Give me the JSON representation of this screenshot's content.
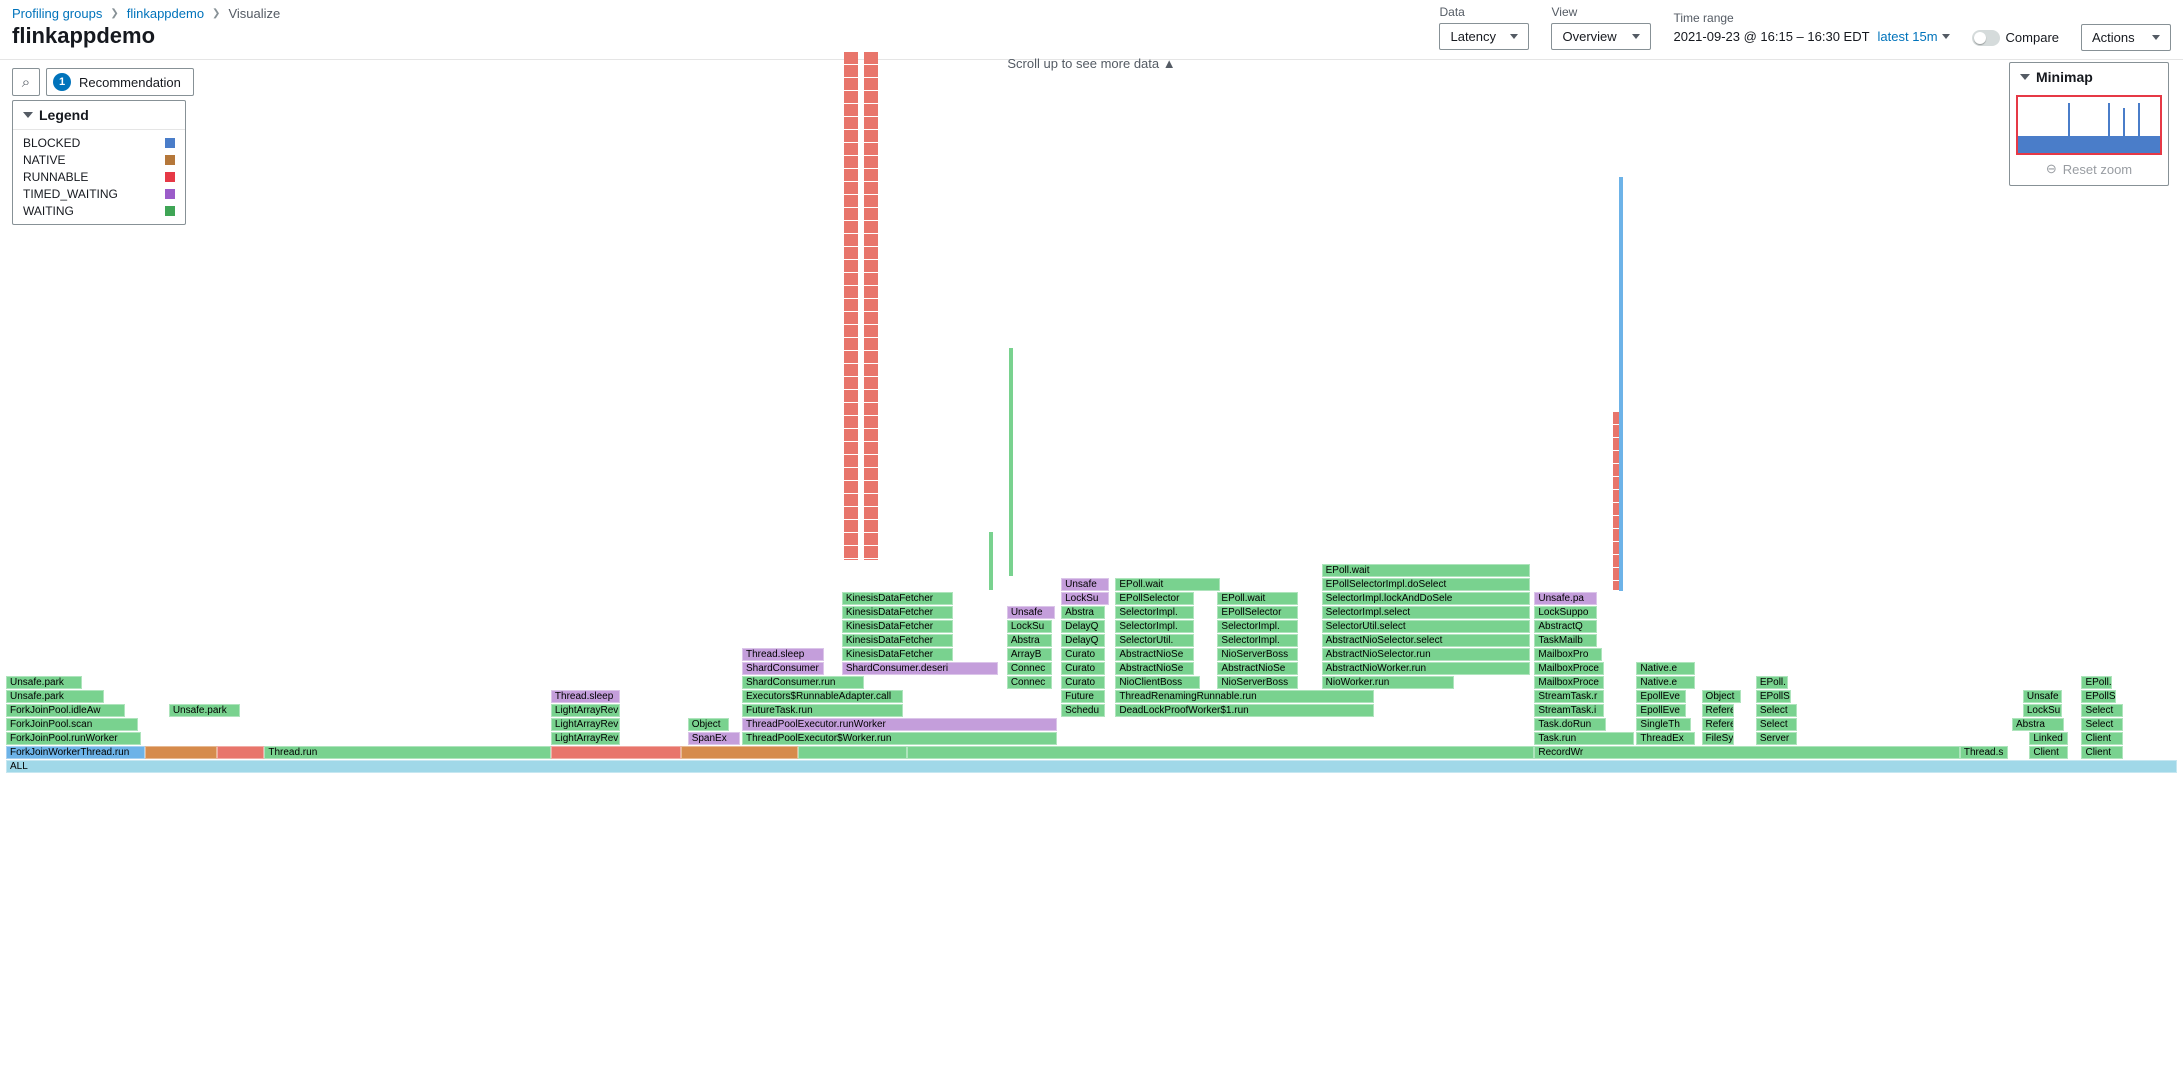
{
  "breadcrumbs": {
    "profiling_groups": "Profiling groups",
    "app": "flinkappdemo",
    "visualize": "Visualize"
  },
  "page_title": "flinkappdemo",
  "controls": {
    "data_label": "Data",
    "data_value": "Latency",
    "view_label": "View",
    "view_value": "Overview",
    "time_range_label": "Time range",
    "time_value": "2021-09-23 @ 16:15 – 16:30 EDT",
    "latest": "latest 15m",
    "compare_label": "Compare",
    "actions": "Actions"
  },
  "recommendation": {
    "count": "1",
    "label": "Recommendation"
  },
  "scroll_hint": "Scroll up to see more data ▲",
  "minimap": {
    "title": "Minimap",
    "reset": "Reset zoom"
  },
  "legend": {
    "title": "Legend",
    "items": [
      {
        "label": "BLOCKED",
        "color": "#4a7dc9"
      },
      {
        "label": "NATIVE",
        "color": "#b5773a"
      },
      {
        "label": "RUNNABLE",
        "color": "#e63946"
      },
      {
        "label": "TIMED_WAITING",
        "color": "#9b5cc9"
      },
      {
        "label": "WAITING",
        "color": "#3fa556"
      }
    ]
  },
  "frames": {
    "all": "ALL",
    "fjwthread": "ForkJoinWorkerThread.run",
    "fjprun": "ForkJoinPool.runWorker",
    "fjpscan": "ForkJoinPool.scan",
    "fjpidle": "ForkJoinPool.idleAw",
    "unsafepark1": "Unsafe.park",
    "unsafepark2": "Unsafe.park",
    "unsafepark3": "Unsafe.park",
    "lightarr1": "LightArrayRev",
    "lightarr2": "LightArrayRev",
    "lightarr3": "LightArrayRev",
    "threadsleep1": "Thread.sleep",
    "threadsleep2": "Thread.sleep",
    "threadrun": "Thread.run",
    "spanex": "SpanEx",
    "object": "Object",
    "tpexworker": "ThreadPoolExecutor$Worker.run",
    "tpexrun": "ThreadPoolExecutor.runWorker",
    "futuretask": "FutureTask.run",
    "execrunnable": "Executors$RunnableAdapter.call",
    "shardconsrun": "ShardConsumer.run",
    "shardcons": "ShardConsumer",
    "shardconsdeseri": "ShardConsumer.deseri",
    "kdf1": "KinesisDataFetcher",
    "kdf2": "KinesisDataFetcher",
    "kdf3": "KinesisDataFetcher",
    "kdf4": "KinesisDataFetcher",
    "kdf5": "KinesisDataFetcher",
    "arrayb": "ArrayB",
    "locksu": "LockSu",
    "abstra": "Abstra",
    "delayq": "DelayQ",
    "unsafe": "Unsafe",
    "connec": "Connec",
    "curato": "Curato",
    "future": "Future",
    "schedu": "Schedu",
    "selectorimpl": "SelectorImpl.",
    "selectorutil": "SelectorUtil.",
    "abstractniose": "AbstractNioSe",
    "nioclientboss": "NioClientBoss",
    "epollwait": "EPoll.wait",
    "epollselector": "EPollSelector",
    "nioserverboss": "NioServerBoss",
    "threadrename": "ThreadRenamingRunnable.run",
    "deadlock": "DeadLockProofWorker$1.run",
    "epollselimpl": "EPollSelectorImpl.doSelect",
    "selimpllock": "SelectorImpl.lockAndDoSele",
    "selimplselect": "SelectorImpl.select",
    "selutilselect": "SelectorUtil.select",
    "abstractnioselect": "AbstractNioSelector.select",
    "abstractnioselrun": "AbstractNioSelector.run",
    "abstractniowork": "AbstractNioWorker.run",
    "nioworkerrun": "NioWorker.run",
    "unsafepa": "Unsafe.pa",
    "locksuppo": "LockSuppo",
    "abstractq": "AbstractQ",
    "taskmailb": "TaskMailb",
    "mailboxpro": "MailboxPro",
    "mailboxproce": "MailboxProce",
    "native_e": "Native.e",
    "streamtaskr": "StreamTask.r",
    "streamtaski": "StreamTask.i",
    "epolleve": "EpollEve",
    "taskdorun": "Task.doRun",
    "taskrun": "Task.run",
    "singleth": "SingleTh",
    "refere": "Refere",
    "select": "Select",
    "threadex": "ThreadEx",
    "filesy": "FileSy",
    "server": "Server",
    "threads": "Thread.s",
    "linked": "Linked",
    "client": "Client",
    "recordwr": "RecordWr",
    "epolls": "EPollS",
    "epoll": "EPoll.",
    "object2": "Object"
  }
}
